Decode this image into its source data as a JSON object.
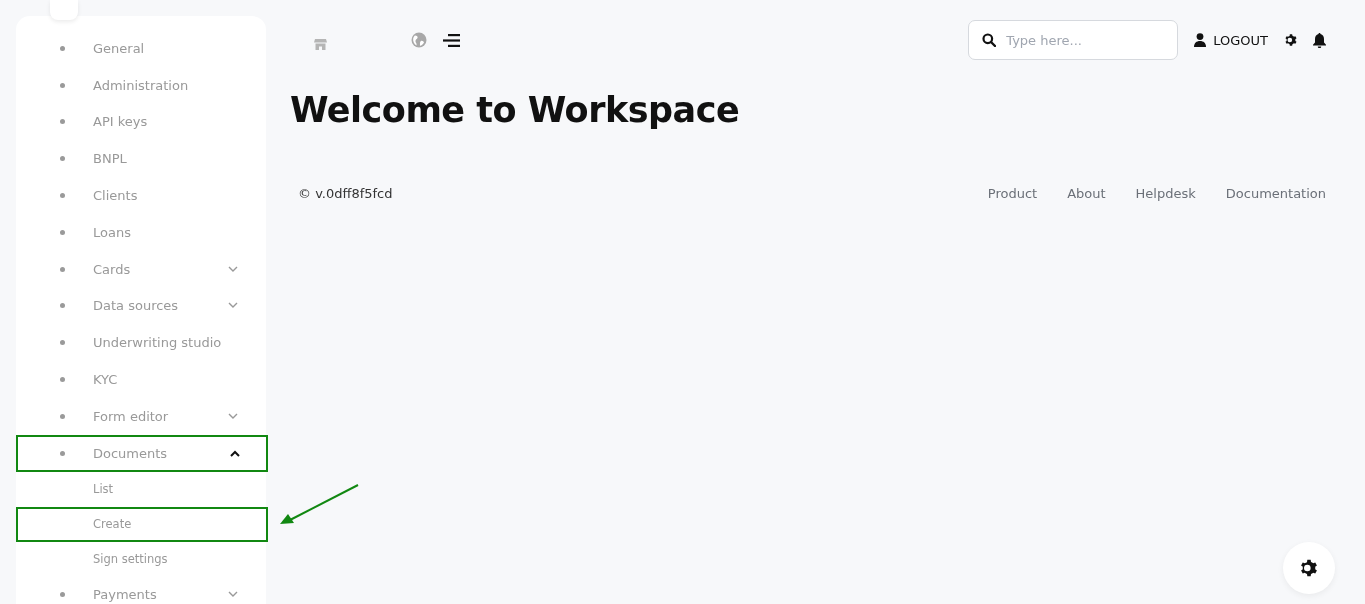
{
  "sidebar": {
    "items": [
      {
        "label": "General",
        "expandable": false,
        "expanded": false,
        "highlighted": false
      },
      {
        "label": "Administration",
        "expandable": false,
        "expanded": false,
        "highlighted": false
      },
      {
        "label": "API keys",
        "expandable": false,
        "expanded": false,
        "highlighted": false
      },
      {
        "label": "BNPL",
        "expandable": false,
        "expanded": false,
        "highlighted": false
      },
      {
        "label": "Clients",
        "expandable": false,
        "expanded": false,
        "highlighted": false
      },
      {
        "label": "Loans",
        "expandable": false,
        "expanded": false,
        "highlighted": false
      },
      {
        "label": "Cards",
        "expandable": true,
        "expanded": false,
        "highlighted": false
      },
      {
        "label": "Data sources",
        "expandable": true,
        "expanded": false,
        "highlighted": false
      },
      {
        "label": "Underwriting studio",
        "expandable": false,
        "expanded": false,
        "highlighted": false
      },
      {
        "label": "KYC",
        "expandable": false,
        "expanded": false,
        "highlighted": false
      },
      {
        "label": "Form editor",
        "expandable": true,
        "expanded": false,
        "highlighted": false
      },
      {
        "label": "Documents",
        "expandable": true,
        "expanded": true,
        "highlighted": true,
        "children": [
          {
            "label": "List",
            "highlighted": false
          },
          {
            "label": "Create",
            "highlighted": true
          },
          {
            "label": "Sign settings",
            "highlighted": false
          }
        ]
      },
      {
        "label": "Payments",
        "expandable": true,
        "expanded": false,
        "highlighted": false
      }
    ]
  },
  "header": {
    "search": {
      "placeholder": "Type here..."
    },
    "logout": "LOGOUT"
  },
  "page": {
    "title": "Welcome to Workspace"
  },
  "footer": {
    "version": "© v.0dff8f5fcd",
    "links": [
      "Product",
      "About",
      "Helpdesk",
      "Documentation"
    ]
  }
}
